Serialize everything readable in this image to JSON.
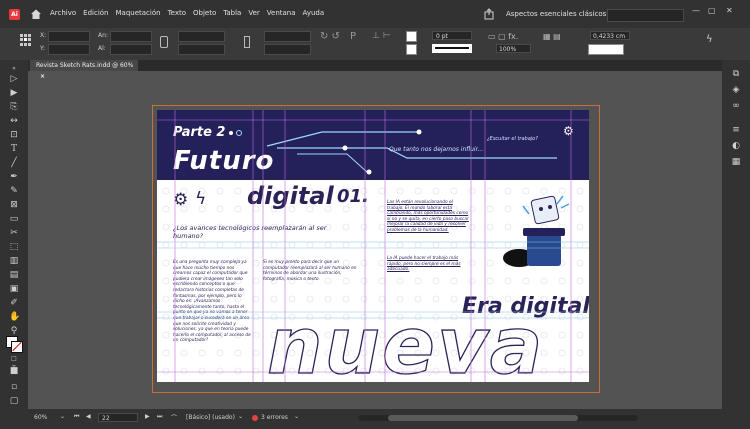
{
  "app": {
    "logo": "Ai",
    "menu": [
      "Archivo",
      "Edición",
      "Maquetación",
      "Texto",
      "Objeto",
      "Tabla",
      "Ver",
      "Ventana",
      "Ayuda"
    ],
    "workspace": "Aspectos esenciales clásicos",
    "window_controls": [
      "—",
      "▢",
      "✕"
    ]
  },
  "control": {
    "x_label": "X:",
    "y_label": "Y:",
    "w_label": "An:",
    "h_label": "Al:",
    "stroke_value": "0 pt",
    "zoom_pct": "100%",
    "size_value": "0,4233 cm"
  },
  "tab": {
    "label": "Revista Sketch Rats.indd @ 60%",
    "close": "×"
  },
  "document": {
    "part_label": "Parte 2",
    "title": "Futuro",
    "subtitle": "digital",
    "number": "01.",
    "tagline": "Que tanto nos dejamos influir...",
    "question": "¿Escuitar el trabajo?",
    "section_q": "¿Los avances tecnológicos reemplazarán al ser humano?",
    "col1": "Es una pregunta muy compleja ya que hace mucho tiempo nos creamos capaz el computador que pudiera crear imágenes tan solo escribiendo conceptos o que redactara historias completas de fantasmas, por ejemplo, pero lo dicho es: ¡Avanzamos tecnológicamente tanto, hasta el punto en que ya no vamos a tener que trabajar o sucederá en un área que nos solicite creatividad y soluciones, ya que en teoría puede hacerlo el computador, al acceso de un computador?",
    "col2": "Si es muy pronto para decir que un computador reemplazará al ser humano en términos de abordar una ilustración, fotografía, música o texto.",
    "col3a": "Las IA están revolucionando el trabajo. El mundo laboral está cambiando, más oportunidades como si no y se quita, en cierto paso buscar mejorar la calidad de vida y resolver problemas de la humanidad.",
    "col3b": "La IA puede hacer el trabajo más rápido, pero no siempre es el más adecuado.",
    "era": "Era digital",
    "big": "nueva"
  },
  "status": {
    "zoom": "60%",
    "page": "22",
    "style": "[Básico] (usado)",
    "errors": "3 errores"
  },
  "colors": {
    "navy": "#2a2358",
    "accent": "#23205a",
    "error_red": "#e64040"
  }
}
